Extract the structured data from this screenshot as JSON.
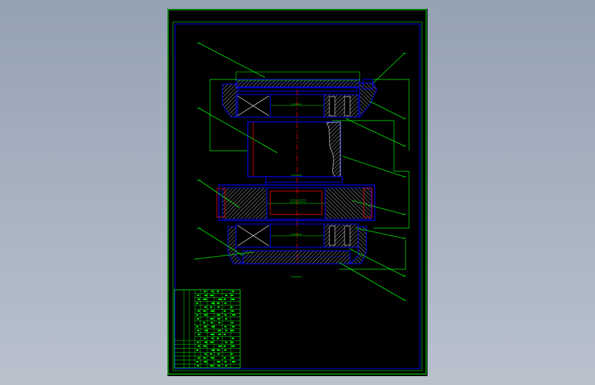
{
  "drawing": {
    "colors": {
      "background_outer": "#a0abbb",
      "sheet": "#000000",
      "frame": "#00ff00",
      "inner_border": "#0000ff",
      "part_outline": "#0000ff",
      "centerline": "#ff0000",
      "hatch": "#ffffff",
      "leader": "#00ff00"
    },
    "balloon_count": 13
  }
}
